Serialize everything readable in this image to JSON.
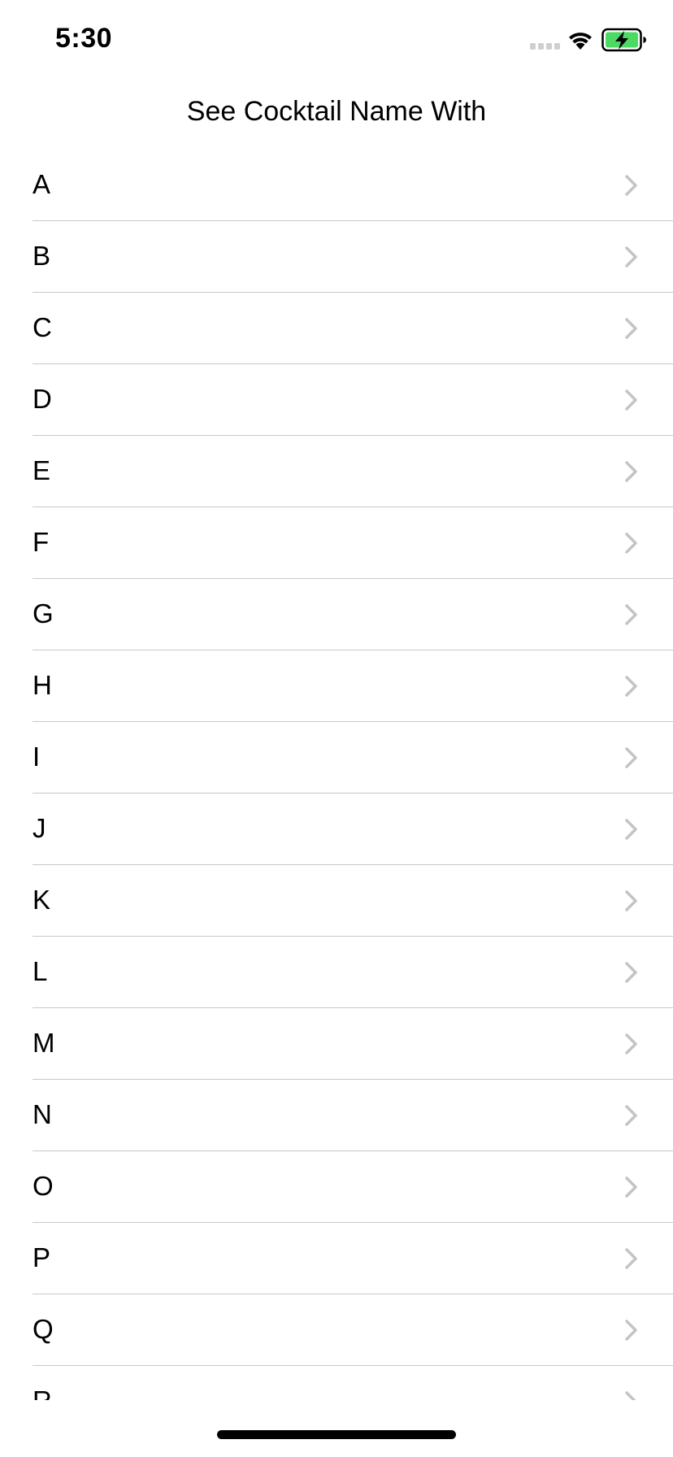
{
  "status_bar": {
    "time": "5:30",
    "battery_color": "#4cd964"
  },
  "nav": {
    "title": "See Cocktail Name With"
  },
  "list": {
    "items": [
      "A",
      "B",
      "C",
      "D",
      "E",
      "F",
      "G",
      "H",
      "I",
      "J",
      "K",
      "L",
      "M",
      "N",
      "O",
      "P",
      "Q",
      "R"
    ]
  },
  "colors": {
    "chevron": "#c4c4c7",
    "divider": "#c8c7cc"
  }
}
